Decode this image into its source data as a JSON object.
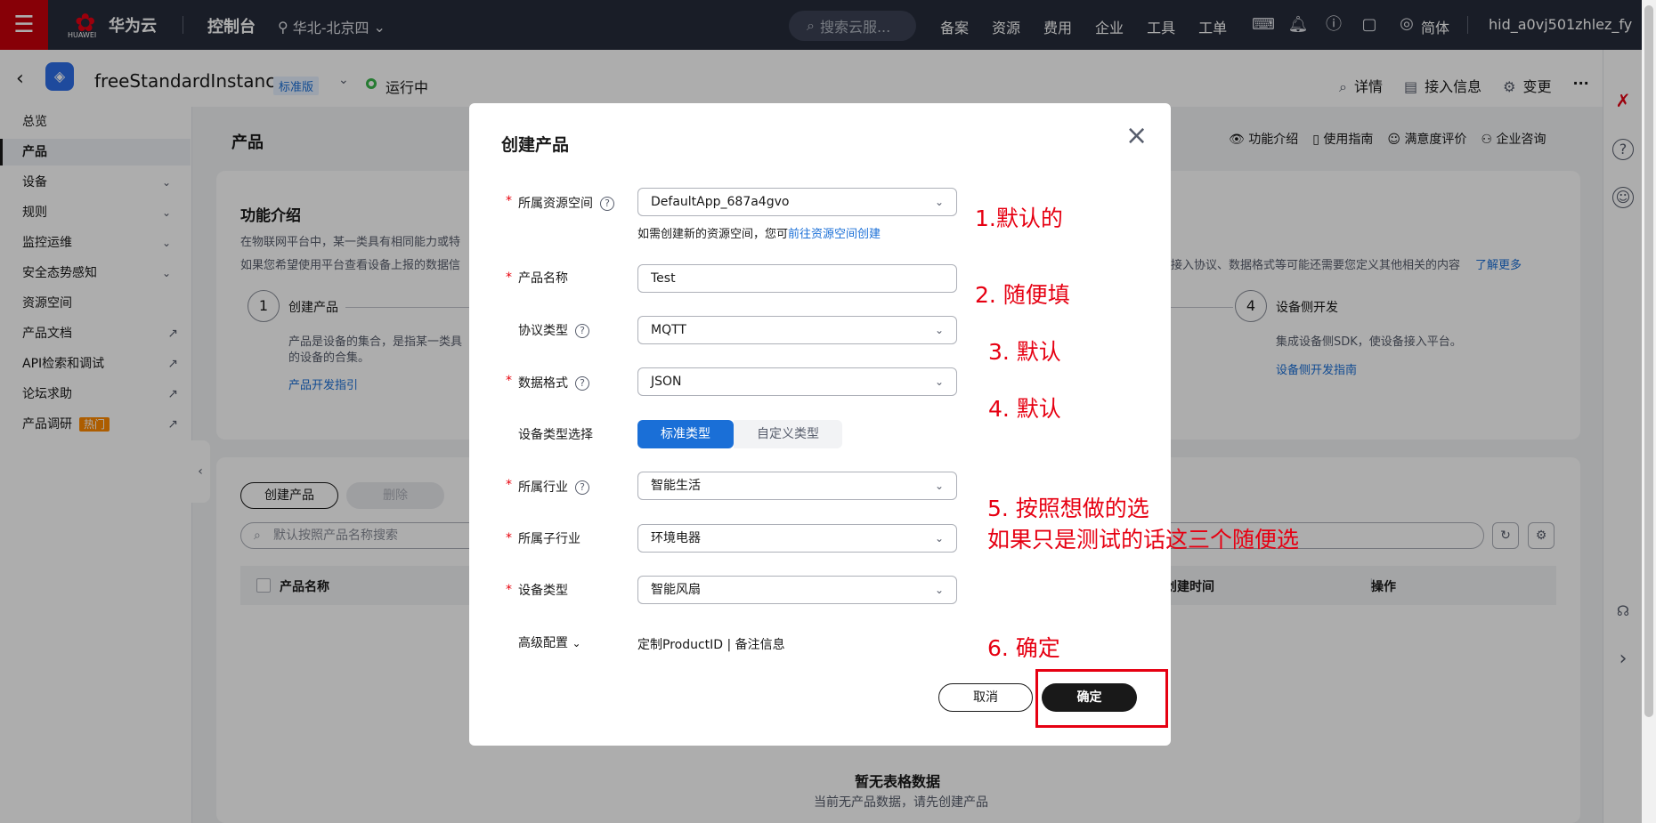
{
  "topbar": {
    "logo_sub": "HUAWEI",
    "brand": "华为云",
    "console": "控制台",
    "region": "华北-北京四",
    "search_placeholder": "搜索云服...",
    "nav": [
      "备案",
      "资源",
      "费用",
      "企业",
      "工具",
      "工单"
    ],
    "lang": "简体",
    "user": "hid_a0vj501zhlez_fy"
  },
  "subheader": {
    "instance": "freeStandardInstance",
    "edition": "标准版",
    "status": "运行中",
    "actions": [
      "详情",
      "接入信息",
      "变更"
    ],
    "more": "···"
  },
  "sidebar": {
    "items": [
      {
        "label": "总览"
      },
      {
        "label": "产品"
      },
      {
        "label": "设备"
      },
      {
        "label": "规则"
      },
      {
        "label": "监控运维"
      },
      {
        "label": "安全态势感知"
      },
      {
        "label": "资源空间"
      },
      {
        "label": "产品文档"
      },
      {
        "label": "API检索和调试"
      },
      {
        "label": "论坛求助"
      },
      {
        "label": "产品调研",
        "badge": "热门"
      }
    ]
  },
  "page": {
    "title": "产品",
    "links": [
      "功能介绍",
      "使用指南",
      "满意度评价",
      "企业咨询"
    ]
  },
  "intro": {
    "title": "功能介绍",
    "line1": "在物联网平台中，某一类具有相同能力或特",
    "line2": "如果您希望使用平台查看设备上报的数据信",
    "line2_tail": "接入协议、数据格式等可能还需要您定义其他相关的内容",
    "learn_more": "了解更多",
    "step1": {
      "num": "1",
      "title": "创建产品",
      "desc1": "产品是设备的集合，是指某一类具",
      "desc2": "的设备的合集。",
      "link": "产品开发指引"
    },
    "step4": {
      "num": "4",
      "title": "设备侧开发",
      "desc": "集成设备侧SDK，使设备接入平台。",
      "link": "设备侧开发指南"
    }
  },
  "table": {
    "create": "创建产品",
    "delete": "删除",
    "search_placeholder": "默认按照产品名称搜索",
    "col_name": "产品名称",
    "col_time": "创建时间",
    "col_ops": "操作",
    "empty_title": "暂无表格数据",
    "empty_desc": "当前无产品数据，请先创建产品"
  },
  "dialog": {
    "title": "创建产品",
    "close": "×",
    "fields": {
      "space": {
        "label": "所属资源空间",
        "value": "DefaultApp_687a4gvo"
      },
      "hint_prefix": "如需创建新的资源空间，您可",
      "hint_link": "前往资源空间创建",
      "name": {
        "label": "产品名称",
        "value": "Test"
      },
      "protocol": {
        "label": "协议类型",
        "value": "MQTT"
      },
      "format": {
        "label": "数据格式",
        "value": "JSON"
      },
      "devtype_sel": {
        "label": "设备类型选择",
        "opt1": "标准类型",
        "opt2": "自定义类型"
      },
      "industry": {
        "label": "所属行业",
        "value": "智能生活"
      },
      "subindustry": {
        "label": "所属子行业",
        "value": "环境电器"
      },
      "devtype": {
        "label": "设备类型",
        "value": "智能风扇"
      },
      "advanced": {
        "label": "高级配置",
        "extra": "定制ProductID | 备注信息"
      }
    },
    "cancel": "取消",
    "ok": "确定"
  },
  "annotations": {
    "n1": "1.默认的",
    "n2": "2. 随便填",
    "n3": "3. 默认",
    "n4": "4. 默认",
    "n5a": "5. 按照想做的选",
    "n5b": "如果只是测试的话这三个随便选",
    "n6": "6. 确定"
  },
  "colors": {
    "accent": "#1a6fd7",
    "brand": "#c7000b",
    "annotation": "#e60012"
  }
}
